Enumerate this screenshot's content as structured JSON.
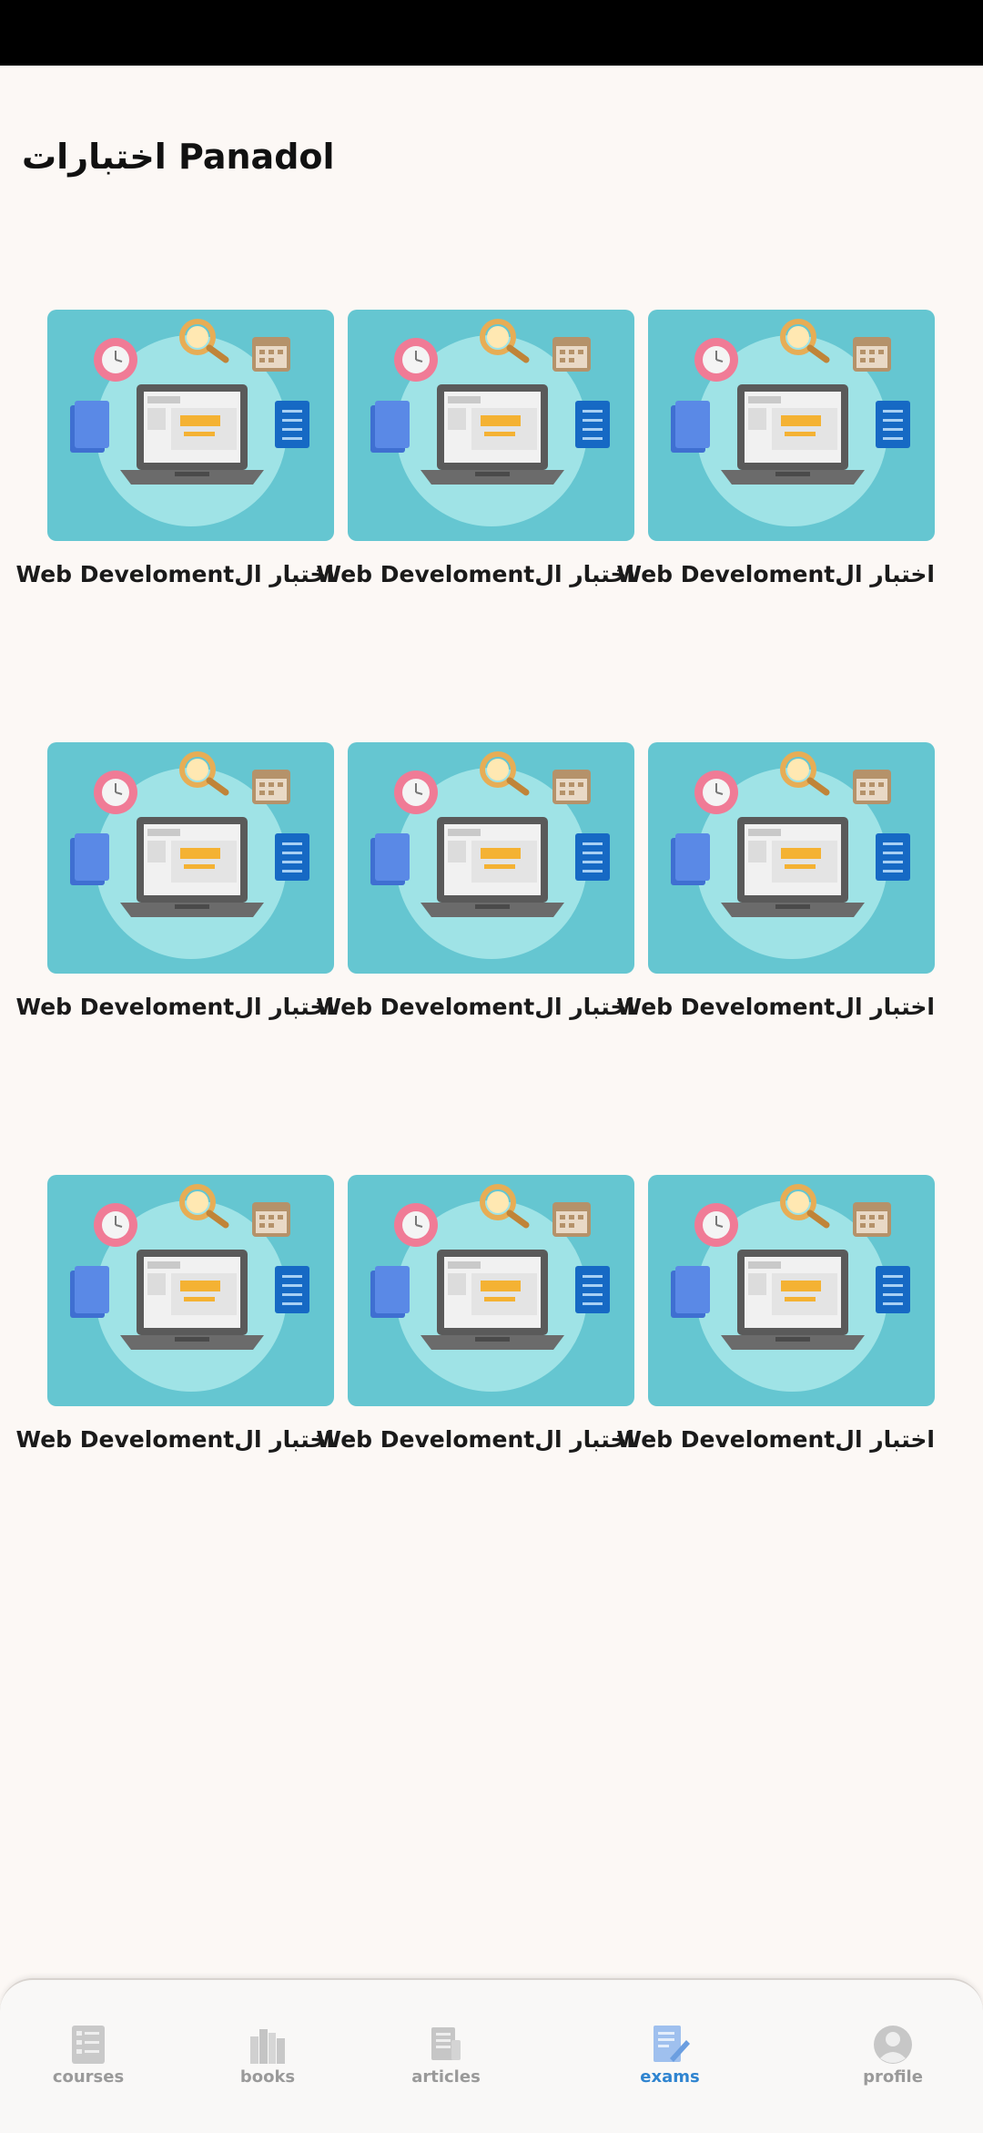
{
  "header": {
    "title": "اختبارات Panadol"
  },
  "exams": [
    {
      "title": "اختبار الWeb Develoment",
      "thumbnail": "laptop-illustration"
    },
    {
      "title": "اختبار الWeb Develoment",
      "thumbnail": "laptop-illustration"
    },
    {
      "title": "اختبار الWeb Develoment",
      "thumbnail": "laptop-illustration"
    },
    {
      "title": "اختبار الWeb Develoment",
      "thumbnail": "laptop-illustration"
    },
    {
      "title": "اختبار الWeb Develoment",
      "thumbnail": "laptop-illustration"
    },
    {
      "title": "اختبار الWeb Develoment",
      "thumbnail": "laptop-illustration"
    },
    {
      "title": "اختبار الWeb Develoment",
      "thumbnail": "laptop-illustration"
    },
    {
      "title": "اختبار الWeb Develoment",
      "thumbnail": "laptop-illustration"
    },
    {
      "title": "اختبار الWeb Develoment",
      "thumbnail": "laptop-illustration"
    }
  ],
  "bottom_nav": {
    "items": [
      {
        "label": "courses",
        "icon": "courses-icon",
        "active": false
      },
      {
        "label": "books",
        "icon": "books-icon",
        "active": false
      },
      {
        "label": "articles",
        "icon": "articles-icon",
        "active": false
      },
      {
        "label": "exams",
        "icon": "exams-icon",
        "active": true
      },
      {
        "label": "profile",
        "icon": "profile-icon",
        "active": false
      }
    ]
  },
  "colors": {
    "background": "#fcf8f5",
    "thumbnail_bg": "#65c6d1",
    "active_nav": "#2f84d0",
    "inactive_nav": "#9a9a9a"
  }
}
